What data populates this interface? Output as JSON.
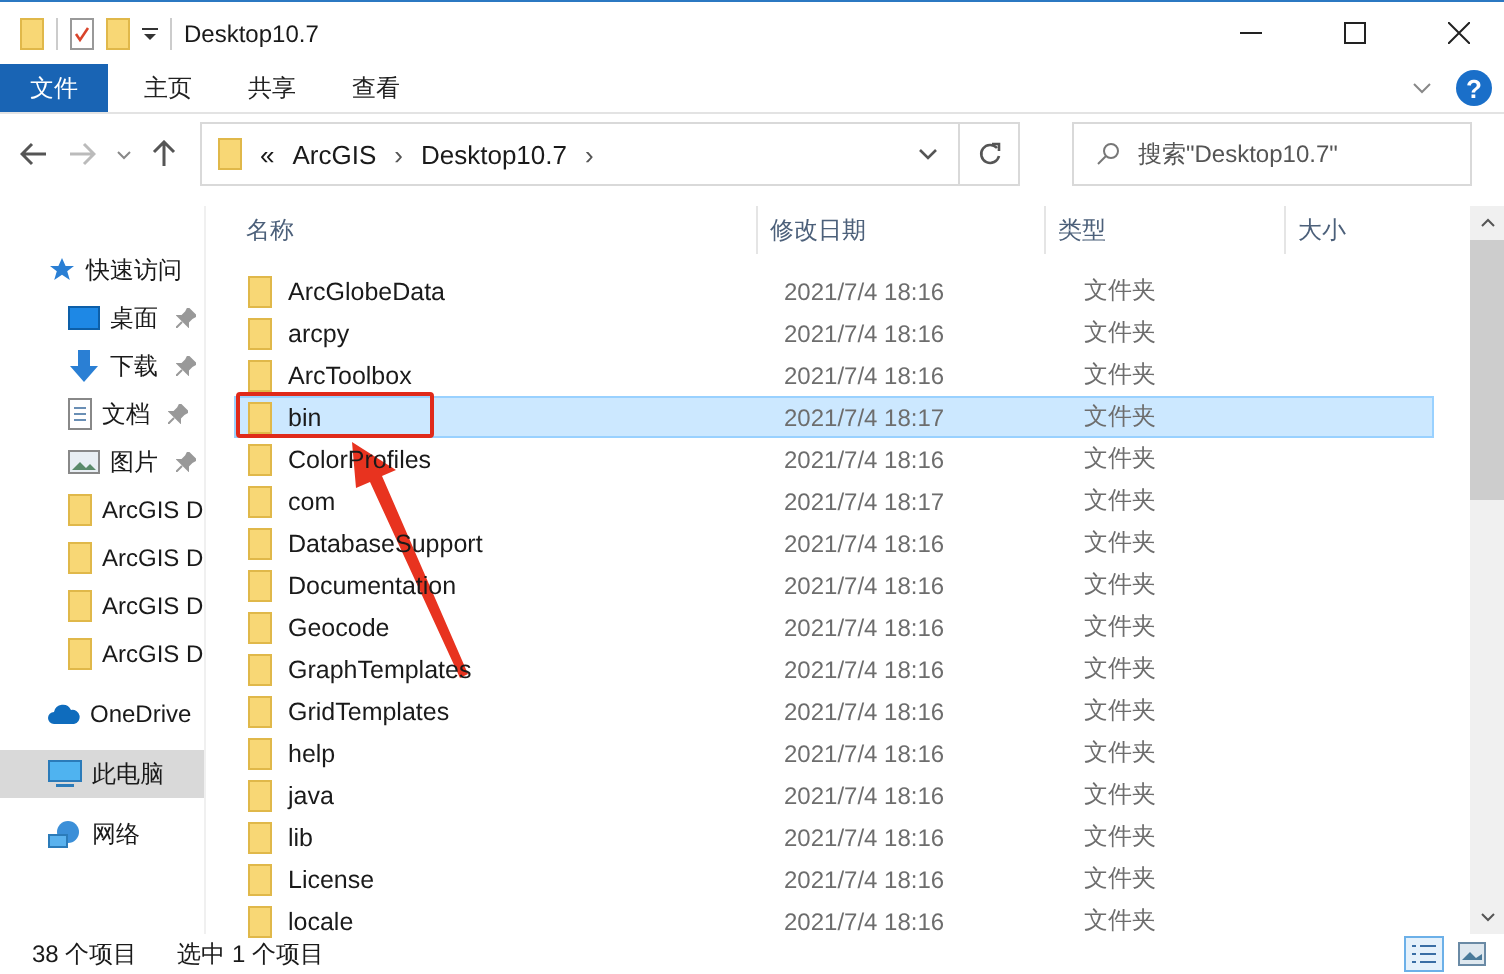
{
  "window": {
    "title": "Desktop10.7"
  },
  "ribbon": {
    "tabs": [
      {
        "label": "文件",
        "selected": true
      },
      {
        "label": "主页",
        "selected": false
      },
      {
        "label": "共享",
        "selected": false
      },
      {
        "label": "查看",
        "selected": false
      }
    ],
    "help": "?"
  },
  "address": {
    "chevron": "«",
    "separator": "›",
    "crumbs": [
      "ArcGIS",
      "Desktop10.7"
    ]
  },
  "search": {
    "placeholder": "搜索\"Desktop10.7\""
  },
  "sidebar": {
    "items": [
      {
        "label": "快速访问",
        "kind": "star",
        "pinned": false,
        "selected": false
      },
      {
        "label": "桌面",
        "kind": "desktop",
        "pinned": true,
        "selected": false
      },
      {
        "label": "下载",
        "kind": "download",
        "pinned": true,
        "selected": false
      },
      {
        "label": "文档",
        "kind": "document",
        "pinned": true,
        "selected": false
      },
      {
        "label": "图片",
        "kind": "pictures",
        "pinned": true,
        "selected": false
      },
      {
        "label": "ArcGIS D",
        "kind": "folder",
        "pinned": false,
        "selected": false
      },
      {
        "label": "ArcGIS D",
        "kind": "folder",
        "pinned": false,
        "selected": false
      },
      {
        "label": "ArcGIS D",
        "kind": "folder",
        "pinned": false,
        "selected": false
      },
      {
        "label": "ArcGIS D",
        "kind": "folder",
        "pinned": false,
        "selected": false
      },
      {
        "label": "OneDrive",
        "kind": "cloud",
        "pinned": false,
        "selected": false
      },
      {
        "label": "此电脑",
        "kind": "pc",
        "pinned": false,
        "selected": true
      },
      {
        "label": "网络",
        "kind": "network",
        "pinned": false,
        "selected": false
      }
    ]
  },
  "table": {
    "columns": [
      "名称",
      "修改日期",
      "类型",
      "大小"
    ],
    "rows": [
      {
        "name": "ArcGlobeData",
        "date": "2021/7/4 18:16",
        "type": "文件夹",
        "selected": false,
        "annotated": false
      },
      {
        "name": "arcpy",
        "date": "2021/7/4 18:16",
        "type": "文件夹",
        "selected": false,
        "annotated": false
      },
      {
        "name": "ArcToolbox",
        "date": "2021/7/4 18:16",
        "type": "文件夹",
        "selected": false,
        "annotated": false
      },
      {
        "name": "bin",
        "date": "2021/7/4 18:17",
        "type": "文件夹",
        "selected": true,
        "annotated": true
      },
      {
        "name": "ColorProfiles",
        "date": "2021/7/4 18:16",
        "type": "文件夹",
        "selected": false,
        "annotated": false
      },
      {
        "name": "com",
        "date": "2021/7/4 18:17",
        "type": "文件夹",
        "selected": false,
        "annotated": false
      },
      {
        "name": "DatabaseSupport",
        "date": "2021/7/4 18:16",
        "type": "文件夹",
        "selected": false,
        "annotated": false
      },
      {
        "name": "Documentation",
        "date": "2021/7/4 18:16",
        "type": "文件夹",
        "selected": false,
        "annotated": false
      },
      {
        "name": "Geocode",
        "date": "2021/7/4 18:16",
        "type": "文件夹",
        "selected": false,
        "annotated": false
      },
      {
        "name": "GraphTemplates",
        "date": "2021/7/4 18:16",
        "type": "文件夹",
        "selected": false,
        "annotated": false
      },
      {
        "name": "GridTemplates",
        "date": "2021/7/4 18:16",
        "type": "文件夹",
        "selected": false,
        "annotated": false
      },
      {
        "name": "help",
        "date": "2021/7/4 18:16",
        "type": "文件夹",
        "selected": false,
        "annotated": false
      },
      {
        "name": "java",
        "date": "2021/7/4 18:16",
        "type": "文件夹",
        "selected": false,
        "annotated": false
      },
      {
        "name": "lib",
        "date": "2021/7/4 18:16",
        "type": "文件夹",
        "selected": false,
        "annotated": false
      },
      {
        "name": "License",
        "date": "2021/7/4 18:16",
        "type": "文件夹",
        "selected": false,
        "annotated": false
      },
      {
        "name": "locale",
        "date": "2021/7/4 18:16",
        "type": "文件夹",
        "selected": false,
        "annotated": false
      }
    ]
  },
  "status_bar": {
    "count": "38 个项目",
    "selection": "选中 1 个项目"
  }
}
